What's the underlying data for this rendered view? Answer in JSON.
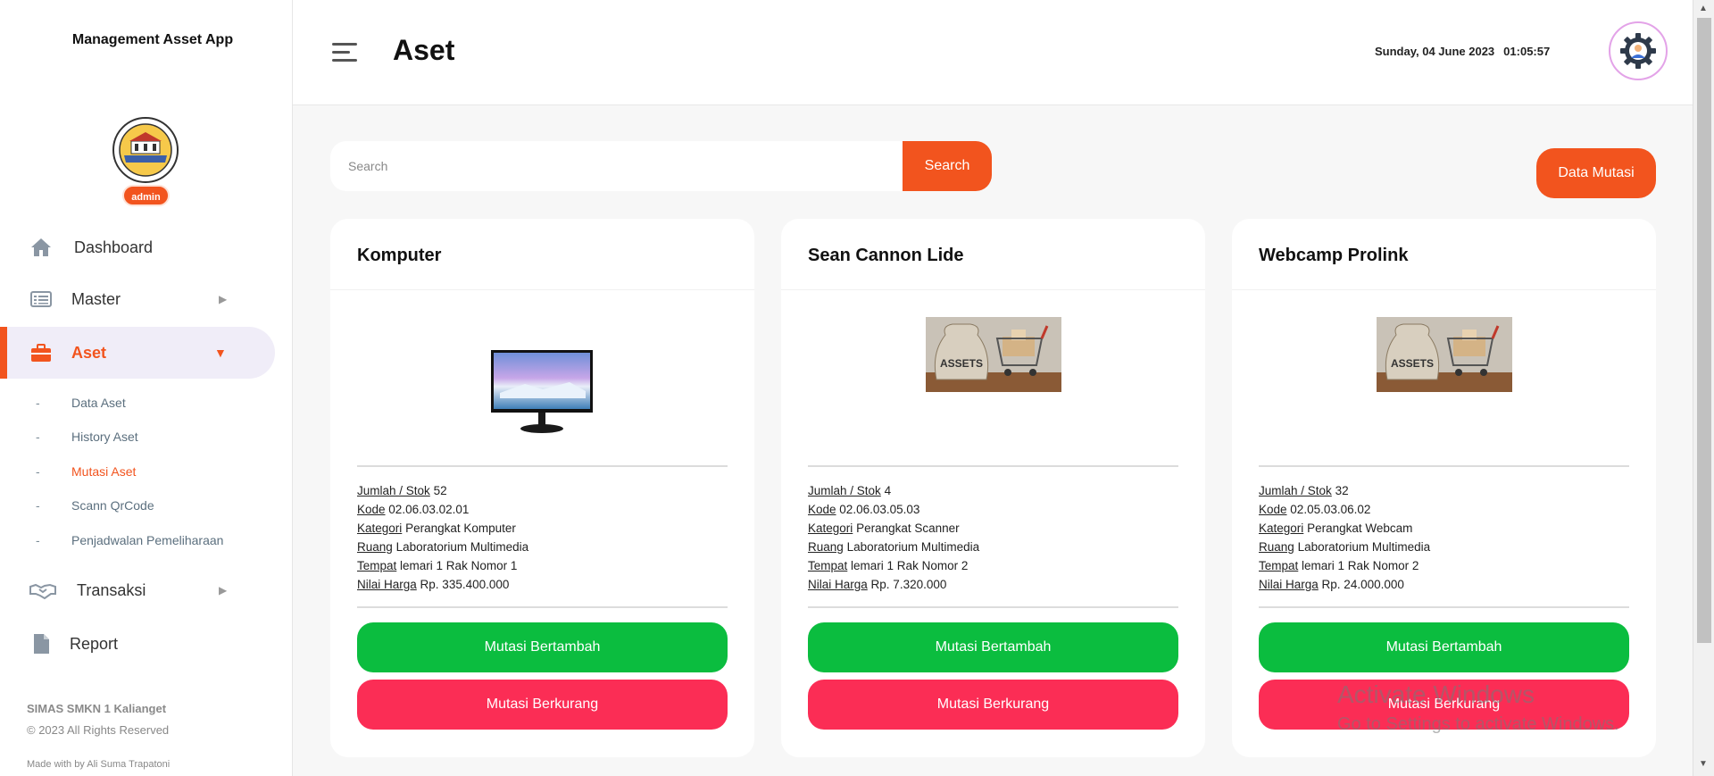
{
  "app_title": "Management Asset App",
  "user_role": "admin",
  "sidebar": {
    "items": [
      {
        "label": "Dashboard"
      },
      {
        "label": "Master"
      },
      {
        "label": "Aset"
      },
      {
        "label": "Transaksi"
      },
      {
        "label": "Report"
      }
    ],
    "submenu": [
      {
        "label": "Data Aset"
      },
      {
        "label": "History Aset"
      },
      {
        "label": "Mutasi Aset"
      },
      {
        "label": "Scann QrCode"
      },
      {
        "label": "Penjadwalan Pemeliharaan"
      }
    ],
    "footer": {
      "brand": "SIMAS SMKN 1 Kalianget",
      "copyright": "© 2023 All Rights Reserved",
      "made_with": "Made with by Ali Suma Trapatoni"
    }
  },
  "header": {
    "title": "Aset",
    "date": "Sunday, 04 June 2023",
    "time": "01:05:57"
  },
  "search": {
    "placeholder": "Search",
    "button_label": "Search"
  },
  "data_mutasi_label": "Data Mutasi",
  "field_labels": {
    "jumlah": "Jumlah / Stok",
    "kode": "Kode",
    "kategori": "Kategori",
    "ruang": "Ruang",
    "tempat": "Tempat",
    "nilai": "Nilai Harga"
  },
  "cards": [
    {
      "title": "Komputer",
      "jumlah": "52",
      "kode": "02.06.03.02.01",
      "kategori": "Perangkat Komputer",
      "ruang": "Laboratorium Multimedia",
      "tempat": "lemari 1 Rak Nomor 1",
      "nilai": "Rp. 335.400.000",
      "btn_add": "Mutasi Bertambah",
      "btn_sub": "Mutasi Berkurang"
    },
    {
      "title": "Sean Cannon Lide",
      "jumlah": "4",
      "kode": "02.06.03.05.03",
      "kategori": "Perangkat Scanner",
      "ruang": "Laboratorium Multimedia",
      "tempat": "lemari 1 Rak Nomor 2",
      "nilai": "Rp. 7.320.000",
      "btn_add": "Mutasi Bertambah",
      "btn_sub": "Mutasi Berkurang"
    },
    {
      "title": "Webcamp Prolink",
      "jumlah": "32",
      "kode": "02.05.03.06.02",
      "kategori": "Perangkat Webcam",
      "ruang": "Laboratorium Multimedia",
      "tempat": "lemari 1 Rak Nomor 2",
      "nilai": "Rp. 24.000.000",
      "btn_add": "Mutasi Bertambah",
      "btn_sub": "Mutasi Berkurang"
    }
  ],
  "watermark": {
    "line1": "Activate Windows",
    "line2": "Go to Settings to activate Windows."
  },
  "colors": {
    "accent": "#f2541e",
    "green": "#0bbd3f",
    "red": "#fb2d55"
  },
  "icons": {
    "dashboard": "home-icon",
    "master": "list-icon",
    "aset": "briefcase-icon",
    "transaksi": "handshake-icon",
    "report": "file-icon",
    "avatar": "gear-user-icon"
  }
}
